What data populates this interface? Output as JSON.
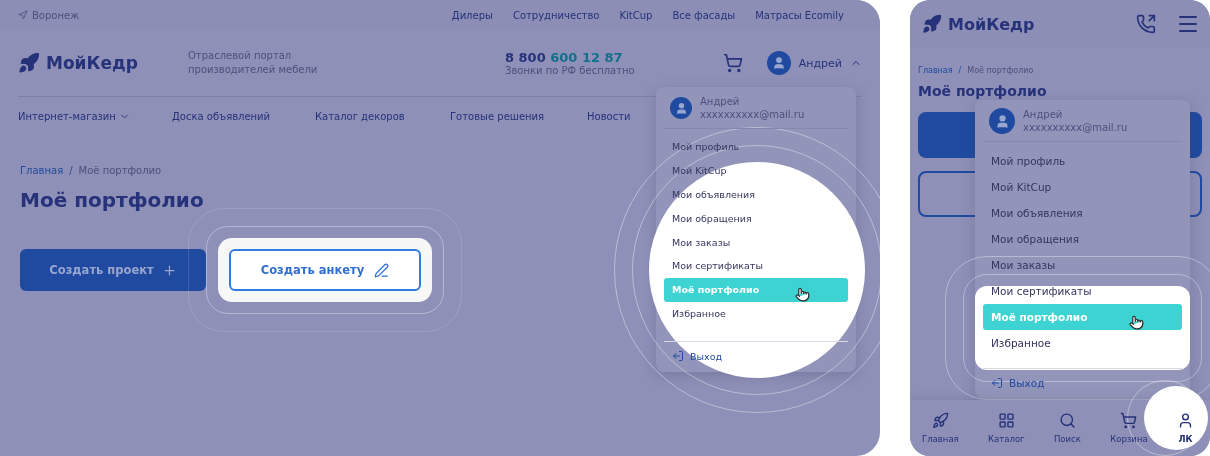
{
  "desktop": {
    "top_bar": {
      "city": "Воронеж",
      "links": [
        "Дилеры",
        "Сотрудничество",
        "KitCup",
        "Все фасады",
        "Матрасы Ecomily"
      ]
    },
    "header": {
      "logo": "МойКедр",
      "tagline": "Отраслевой портал производителей мебели",
      "phone_code": "8 800",
      "phone_number": "600 12 87",
      "phone_note": "Звонки по РФ бесплатно",
      "user_name": "Андрей"
    },
    "nav": [
      {
        "label": "Интернет-магазин",
        "kind": "dropdown"
      },
      {
        "label": "Доска объявлений",
        "kind": "link"
      },
      {
        "label": "Каталог декоров",
        "kind": "link"
      },
      {
        "label": "Готовые решения",
        "kind": "link"
      },
      {
        "label": "Новости",
        "kind": "link"
      }
    ],
    "breadcrumbs": [
      "Главная",
      "Моё портфолио"
    ],
    "breadcrumb_separator": "/",
    "title": "Моё портфолио",
    "buttons": [
      {
        "label": "Создать проект",
        "kind": "primary"
      },
      {
        "label": "Создать анкету",
        "kind": "outline"
      }
    ],
    "dropdown": {
      "name": "Андрей",
      "email": "xxxxxxxxxx@mail.ru",
      "items": [
        {
          "label": "Мой профиль",
          "selected": false
        },
        {
          "label": "Мой KitCup",
          "selected": false
        },
        {
          "label": "Мои объявления",
          "selected": false
        },
        {
          "label": "Мои обращения",
          "selected": false
        },
        {
          "label": "Мои заказы",
          "selected": false
        },
        {
          "label": "Мои сертификаты",
          "selected": false
        },
        {
          "label": "Моё портфолио",
          "selected": true
        },
        {
          "label": "Избранное",
          "selected": false
        }
      ],
      "logout": "Выход"
    }
  },
  "mobile": {
    "logo": "МойКедр",
    "breadcrumbs": [
      "Главная",
      "Моё портфолио"
    ],
    "breadcrumb_separator": "/",
    "title": "Моё портфолио",
    "dropdown": {
      "name": "Андрей",
      "email": "xxxxxxxxxx@mail.ru",
      "items": [
        {
          "label": "Мой профиль",
          "selected": false
        },
        {
          "label": "Мой KitCup",
          "selected": false
        },
        {
          "label": "Мои объявления",
          "selected": false
        },
        {
          "label": "Мои обращения",
          "selected": false
        },
        {
          "label": "Мои заказы",
          "selected": false
        },
        {
          "label": "Мои сертификаты",
          "selected": false
        },
        {
          "label": "Моё портфолио",
          "selected": true
        },
        {
          "label": "Избранное",
          "selected": false
        }
      ],
      "logout": "Выход"
    },
    "bottom_nav": [
      {
        "label": "Главная",
        "kind": "home",
        "selected": false
      },
      {
        "label": "Каталог",
        "kind": "catalog",
        "selected": false
      },
      {
        "label": "Поиск",
        "kind": "search",
        "selected": false
      },
      {
        "label": "Корзина",
        "kind": "cart",
        "selected": false
      },
      {
        "label": "ЛК",
        "kind": "account",
        "selected": true
      }
    ]
  }
}
